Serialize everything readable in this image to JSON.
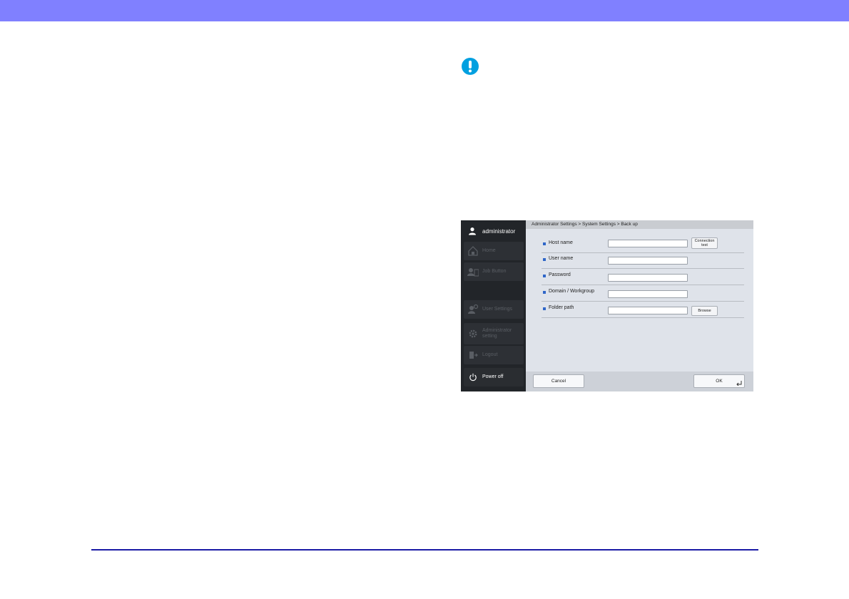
{
  "colors": {
    "top_band": "#8080ff",
    "important_icon": "#00a0e0",
    "footer_rule": "#1a1aa6",
    "sidebar_bg": "#222529",
    "main_bg": "#dfe3ea",
    "field_bullet": "#2f66c8"
  },
  "notice": {
    "icon": "exclamation-icon"
  },
  "device": {
    "user": {
      "icon": "user-icon",
      "name": "administrator"
    },
    "sidebar": {
      "items": [
        {
          "label": "Home",
          "icon": "home-icon"
        },
        {
          "label": "Job Button",
          "icon": "job-button-icon"
        },
        {
          "label": "User Settings",
          "icon": "user-settings-icon"
        },
        {
          "label": "Administrator setting",
          "icon": "gear-icon"
        },
        {
          "label": "Logout",
          "icon": "logout-icon"
        },
        {
          "label": "Power off",
          "icon": "power-icon"
        }
      ]
    },
    "breadcrumb": "Administrator Settings > System Settings > Back up",
    "form": {
      "fields": [
        {
          "label": "Host name",
          "value": ""
        },
        {
          "label": "User name",
          "value": ""
        },
        {
          "label": "Password",
          "value": ""
        },
        {
          "label": "Domain / Workgroup",
          "value": ""
        },
        {
          "label": "Folder path",
          "value": ""
        }
      ],
      "connection_test_label": "Connection test",
      "browse_label": "Browse"
    },
    "footer": {
      "cancel_label": "Cancel",
      "ok_label": "OK"
    }
  }
}
